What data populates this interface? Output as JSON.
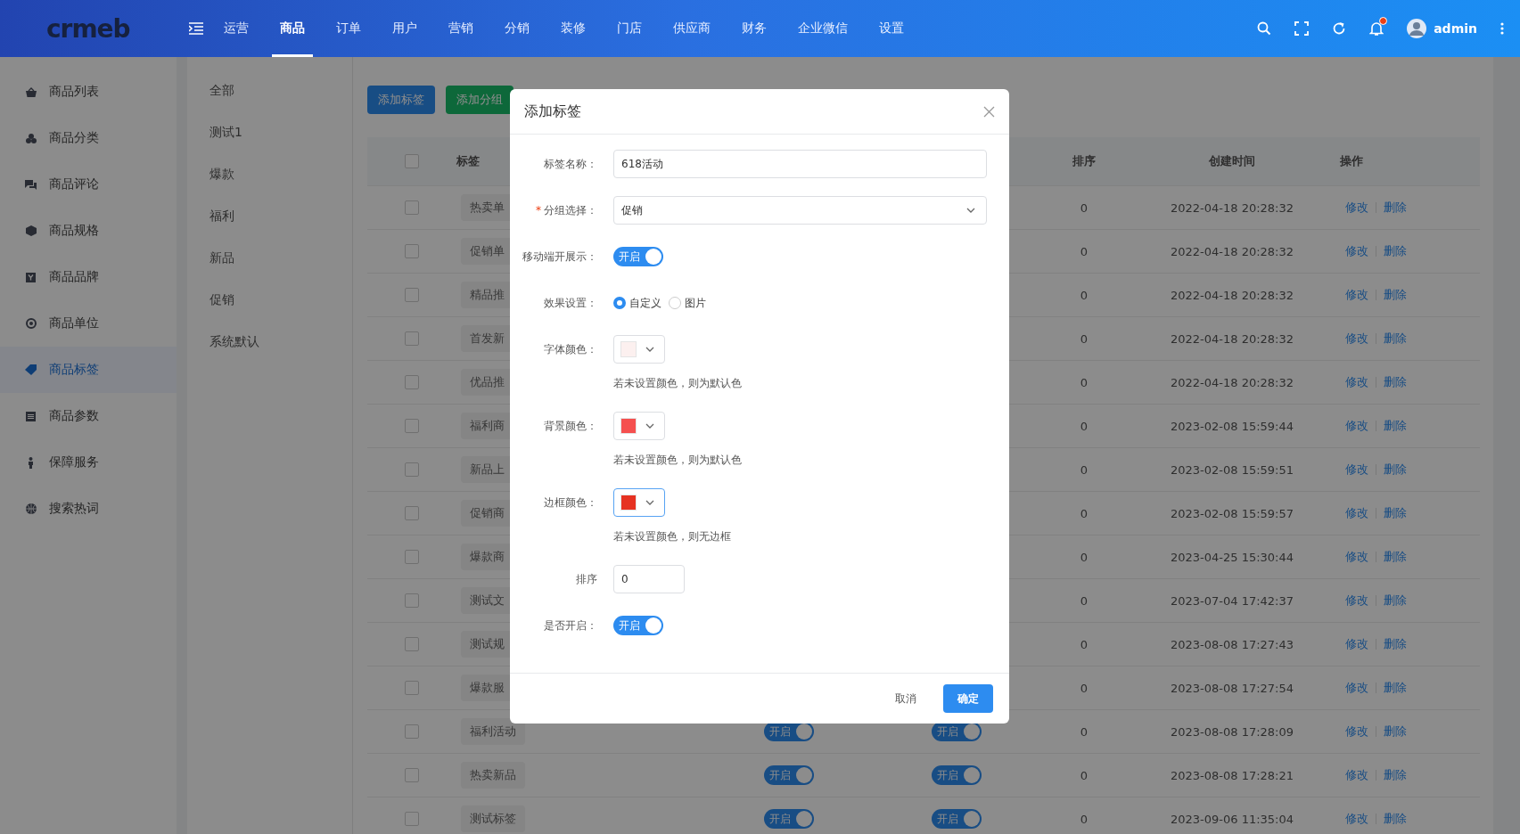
{
  "header": {
    "logo": "crmeb",
    "nav": [
      {
        "label": "运营",
        "selected": false
      },
      {
        "label": "商品",
        "selected": true
      },
      {
        "label": "订单",
        "selected": false
      },
      {
        "label": "用户",
        "selected": false
      },
      {
        "label": "营销",
        "selected": false
      },
      {
        "label": "分销",
        "selected": false
      },
      {
        "label": "装修",
        "selected": false
      },
      {
        "label": "门店",
        "selected": false
      },
      {
        "label": "供应商",
        "selected": false
      },
      {
        "label": "财务",
        "selected": false
      },
      {
        "label": "企业微信",
        "selected": false
      },
      {
        "label": "设置",
        "selected": false
      }
    ],
    "notification": true,
    "user": "admin"
  },
  "sidebar": {
    "items": [
      {
        "label": "商品列表",
        "selected": false
      },
      {
        "label": "商品分类",
        "selected": false
      },
      {
        "label": "商品评论",
        "selected": false
      },
      {
        "label": "商品规格",
        "selected": false
      },
      {
        "label": "商品品牌",
        "selected": false
      },
      {
        "label": "商品单位",
        "selected": false
      },
      {
        "label": "商品标签",
        "selected": true
      },
      {
        "label": "商品参数",
        "selected": false
      },
      {
        "label": "保障服务",
        "selected": false
      },
      {
        "label": "搜索热词",
        "selected": false
      }
    ]
  },
  "groups": [
    "全部",
    "测试1",
    "爆款",
    "福利",
    "新品",
    "促销",
    "系统默认"
  ],
  "toolbar": {
    "buttons": [
      {
        "label": "添加标签",
        "kind": "primary"
      },
      {
        "label": "添加分组",
        "kind": "success"
      }
    ]
  },
  "table": {
    "select_all": {
      "checked": false
    },
    "columns": [
      "标签",
      "排序",
      "创建时间",
      "操作"
    ],
    "rows": [
      {
        "checked": false,
        "tag": "热卖单",
        "sort": "0",
        "created": "2022-04-18 20:28:32",
        "actions": [
          "修改",
          "删除"
        ]
      },
      {
        "checked": false,
        "tag": "促销单",
        "sort": "0",
        "created": "2022-04-18 20:28:32",
        "actions": [
          "修改",
          "删除"
        ]
      },
      {
        "checked": false,
        "tag": "精品推",
        "sort": "0",
        "created": "2022-04-18 20:28:32",
        "actions": [
          "修改",
          "删除"
        ]
      },
      {
        "checked": false,
        "tag": "首发新",
        "sort": "0",
        "created": "2022-04-18 20:28:32",
        "actions": [
          "修改",
          "删除"
        ]
      },
      {
        "checked": false,
        "tag": "优品推",
        "sort": "0",
        "created": "2022-04-18 20:28:32",
        "actions": [
          "修改",
          "删除"
        ]
      },
      {
        "checked": false,
        "tag": "福利商",
        "sort": "0",
        "created": "2023-02-08 15:59:44",
        "actions": [
          "修改",
          "删除"
        ]
      },
      {
        "checked": false,
        "tag": "新品上",
        "sort": "0",
        "created": "2023-02-08 15:59:51",
        "actions": [
          "修改",
          "删除"
        ]
      },
      {
        "checked": false,
        "tag": "促销商",
        "sort": "0",
        "created": "2023-02-08 15:59:57",
        "actions": [
          "修改",
          "删除"
        ]
      },
      {
        "checked": false,
        "tag": "爆款商",
        "sort": "0",
        "created": "2023-04-25 15:30:44",
        "actions": [
          "修改",
          "删除"
        ]
      },
      {
        "checked": false,
        "tag": "测试文",
        "sort": "0",
        "created": "2023-07-04 17:42:37",
        "actions": [
          "修改",
          "删除"
        ]
      },
      {
        "checked": false,
        "tag": "测试规",
        "sort": "0",
        "created": "2023-08-08 17:27:43",
        "actions": [
          "修改",
          "删除"
        ]
      },
      {
        "checked": false,
        "tag": "爆款服",
        "sort": "0",
        "created": "2023-08-08 17:27:54",
        "actions": [
          "修改",
          "删除"
        ]
      },
      {
        "checked": false,
        "tag": "福利活动",
        "switches": [
          {
            "label": "开启",
            "on": true
          },
          {
            "label": "开启",
            "on": true
          }
        ],
        "sort": "0",
        "created": "2023-08-08 17:28:09",
        "actions": [
          "修改",
          "删除"
        ]
      },
      {
        "checked": false,
        "tag": "热卖新品",
        "switches": [
          {
            "label": "开启",
            "on": true
          },
          {
            "label": "开启",
            "on": true
          }
        ],
        "sort": "0",
        "created": "2023-08-08 17:28:21",
        "actions": [
          "修改",
          "删除"
        ]
      },
      {
        "checked": false,
        "tag": "测试标签",
        "switches": [
          {
            "label": "开启",
            "on": true
          },
          {
            "label": "开启",
            "on": true
          }
        ],
        "sort": "0",
        "created": "2023-09-06 11:35:04",
        "actions": [
          "修改",
          "删除"
        ]
      }
    ]
  },
  "dialog": {
    "title": "添加标签",
    "fields": [
      {
        "kind": "text",
        "label": "标签名称：",
        "value": "618活动"
      },
      {
        "kind": "select",
        "label": "分组选择：",
        "required_mark": "*",
        "value": "促销"
      },
      {
        "kind": "switch",
        "label": "移动端开展示：",
        "on": true,
        "text": "开启"
      },
      {
        "kind": "radio",
        "label": "效果设置：",
        "options": [
          {
            "label": "自定义",
            "selected": true
          },
          {
            "label": "图片",
            "selected": false
          }
        ]
      },
      {
        "kind": "color",
        "label": "字体颜色：",
        "color": "#fcf0ef",
        "focused": false,
        "hint": "若未设置颜色，则为默认色"
      },
      {
        "kind": "color",
        "label": "背景颜色：",
        "color": "#f5504f",
        "focused": false,
        "hint": "若未设置颜色，则为默认色"
      },
      {
        "kind": "color",
        "label": "边框颜色：",
        "color": "#e63222",
        "focused": true,
        "hint": "若未设置颜色，则无边框"
      },
      {
        "kind": "number",
        "label": "排序",
        "value": "0"
      },
      {
        "kind": "switch",
        "label": "是否开启：",
        "on": true,
        "text": "开启"
      }
    ],
    "buttons": [
      {
        "label": "取消",
        "kind": "default"
      },
      {
        "label": "确定",
        "kind": "primary"
      }
    ]
  }
}
